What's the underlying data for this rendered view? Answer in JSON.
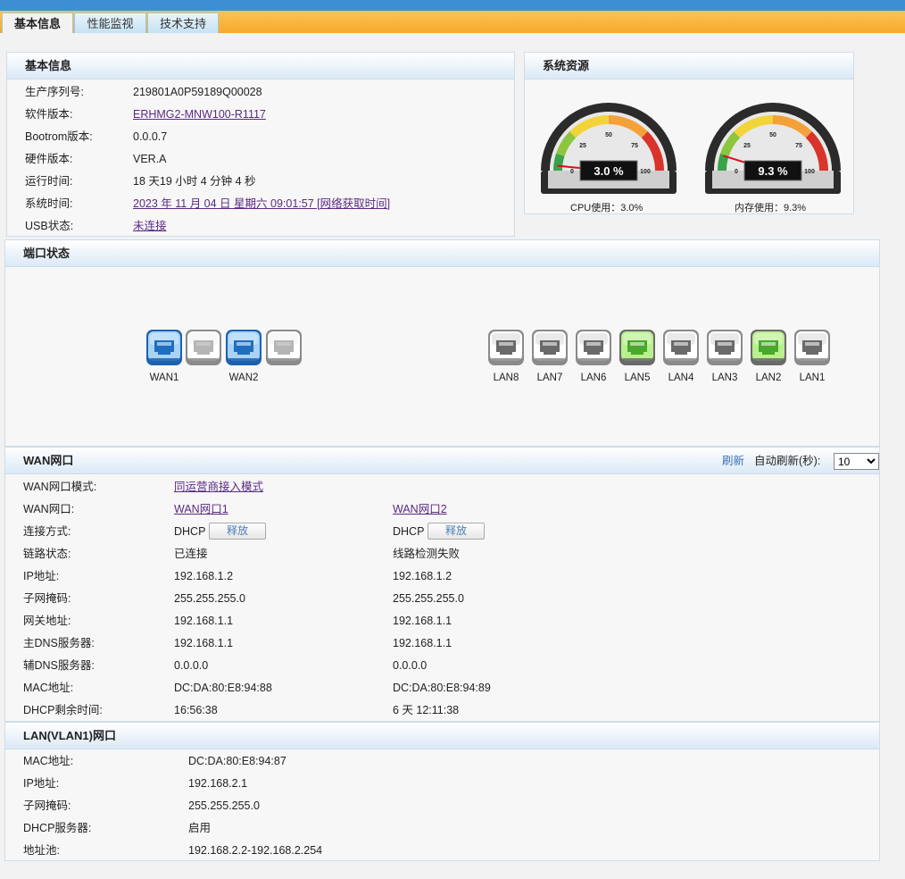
{
  "tabs": [
    {
      "label": "基本信息",
      "active": true
    },
    {
      "label": "性能监视",
      "active": false
    },
    {
      "label": "技术支持",
      "active": false
    }
  ],
  "basic_info": {
    "title": "基本信息",
    "rows": [
      {
        "label": "生产序列号:",
        "value": "219801A0P59189Q00028",
        "link": false
      },
      {
        "label": "软件版本:",
        "value": "ERHMG2-MNW100-R1117",
        "link": true
      },
      {
        "label": "Bootrom版本:",
        "value": "0.0.0.7",
        "link": false
      },
      {
        "label": "硬件版本:",
        "value": "VER.A",
        "link": false
      },
      {
        "label": "运行时间:",
        "value": "18 天19 小时 4 分钟 4 秒",
        "link": false
      },
      {
        "label": "系统时间:",
        "value": "2023 年 11 月 04 日 星期六 09:01:57  [网络获取时间]",
        "link": true
      },
      {
        "label": "USB状态:",
        "value": "未连接",
        "link": true
      }
    ]
  },
  "system_resources": {
    "title": "系统资源",
    "cpu": {
      "percent": 3.0,
      "display": "3.0 %",
      "caption": "CPU使用：3.0%"
    },
    "mem": {
      "percent": 9.3,
      "display": "9.3 %",
      "caption": "内存使用：9.3%"
    },
    "scale": [
      "0",
      "25",
      "50",
      "75",
      "100"
    ]
  },
  "port_status": {
    "title": "端口状态",
    "wan": [
      {
        "label": "WAN1",
        "state": "active"
      },
      {
        "label": "",
        "state": "off"
      },
      {
        "label": "WAN2",
        "state": "active"
      },
      {
        "label": "",
        "state": "off"
      }
    ],
    "lan": [
      {
        "label": "LAN8",
        "state": "gray"
      },
      {
        "label": "LAN7",
        "state": "gray"
      },
      {
        "label": "LAN6",
        "state": "gray"
      },
      {
        "label": "LAN5",
        "state": "green"
      },
      {
        "label": "LAN4",
        "state": "gray"
      },
      {
        "label": "LAN3",
        "state": "gray"
      },
      {
        "label": "LAN2",
        "state": "green"
      },
      {
        "label": "LAN1",
        "state": "gray"
      }
    ],
    "colors": {
      "active": "#1f6fc1",
      "green": "#4aa82c",
      "gray": "#6a6a6a"
    }
  },
  "wan_ports": {
    "title": "WAN网口",
    "refresh": "刷新",
    "auto_refresh_label": "自动刷新(秒):",
    "auto_refresh_value": "10",
    "mode_label": "WAN网口模式:",
    "mode_value": "同运营商接入模式",
    "port_label": "WAN网口:",
    "port1": "WAN网口1",
    "port2": "WAN网口2",
    "release": "释放",
    "rows": [
      {
        "label": "连接方式:",
        "v1": "DHCP",
        "v2": "DHCP"
      },
      {
        "label": "链路状态:",
        "v1": "已连接",
        "v2": "线路检测失败"
      },
      {
        "label": "IP地址:",
        "v1": "192.168.1.2",
        "v2": "192.168.1.2"
      },
      {
        "label": "子网掩码:",
        "v1": "255.255.255.0",
        "v2": "255.255.255.0"
      },
      {
        "label": "网关地址:",
        "v1": "192.168.1.1",
        "v2": "192.168.1.1"
      },
      {
        "label": "主DNS服务器:",
        "v1": "192.168.1.1",
        "v2": "192.168.1.1"
      },
      {
        "label": "辅DNS服务器:",
        "v1": "0.0.0.0",
        "v2": "0.0.0.0"
      },
      {
        "label": "MAC地址:",
        "v1": "DC:DA:80:E8:94:88",
        "v2": "DC:DA:80:E8:94:89"
      },
      {
        "label": "DHCP剩余时间:",
        "v1": "16:56:38",
        "v2": "6 天 12:11:38"
      }
    ]
  },
  "lan_port": {
    "title": "LAN(VLAN1)网口",
    "rows": [
      {
        "label": "MAC地址:",
        "value": "DC:DA:80:E8:94:87"
      },
      {
        "label": "IP地址:",
        "value": "192.168.2.1"
      },
      {
        "label": "子网掩码:",
        "value": "255.255.255.0"
      },
      {
        "label": "DHCP服务器:",
        "value": "启用"
      },
      {
        "label": "地址池:",
        "value": "192.168.2.2-192.168.2.254"
      }
    ]
  }
}
